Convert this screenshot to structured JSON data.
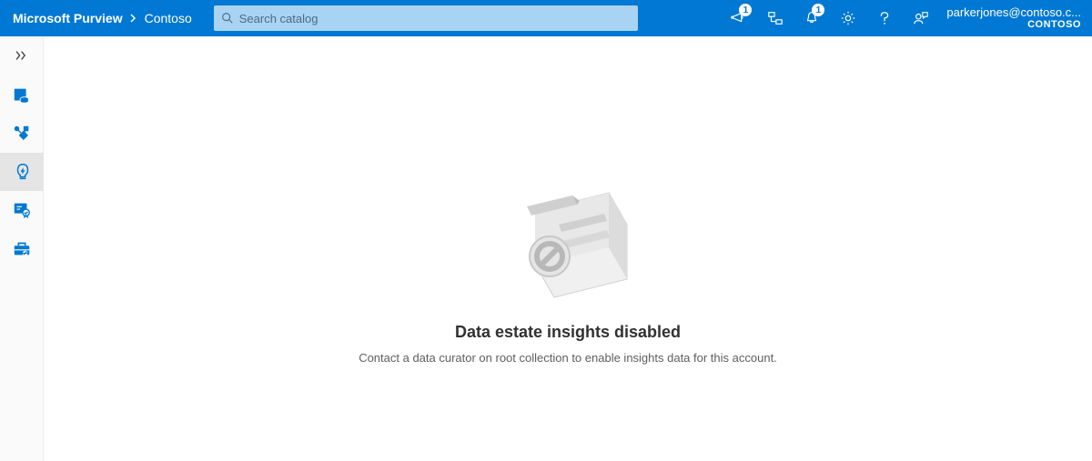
{
  "header": {
    "brand": "Microsoft Purview",
    "org": "Contoso",
    "search_placeholder": "Search catalog",
    "feedback_badge": "1",
    "notifications_badge": "1",
    "user_email": "parkerjones@contoso.c...",
    "user_org": "CONTOSO"
  },
  "sidebar": {
    "items": [
      {
        "name": "expand",
        "icon": "expand"
      },
      {
        "name": "data-catalog",
        "icon": "catalog"
      },
      {
        "name": "data-map",
        "icon": "datamap"
      },
      {
        "name": "insights",
        "icon": "insights",
        "selected": true
      },
      {
        "name": "policy",
        "icon": "policy"
      },
      {
        "name": "management",
        "icon": "management"
      }
    ]
  },
  "content": {
    "title": "Data estate insights disabled",
    "subtitle": "Contact a data curator on root collection to enable insights data for this account."
  },
  "colors": {
    "primary": "#0078d4",
    "searchbg": "#a9d3f2"
  }
}
